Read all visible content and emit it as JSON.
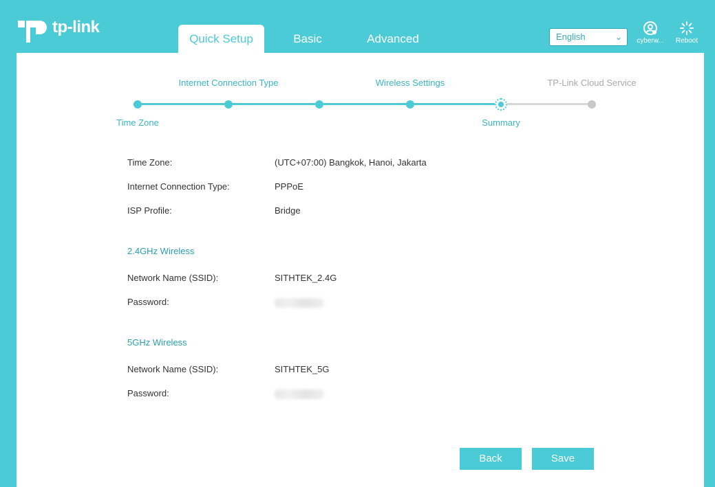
{
  "header": {
    "logo_text": "tp-link",
    "tabs": [
      {
        "label": "Quick Setup",
        "active": true
      },
      {
        "label": "Basic",
        "active": false
      },
      {
        "label": "Advanced",
        "active": false
      }
    ],
    "language": {
      "selected": "English"
    },
    "user_label": "cyberw...",
    "reboot_label": "Reboot"
  },
  "colors": {
    "accent": "#4acbd6",
    "inactive": "#c8c8c8",
    "section_text": "#2a9fb0"
  },
  "progress": {
    "steps": [
      {
        "label": "Time Zone",
        "state": "done"
      },
      {
        "label": "Internet Connection Type",
        "state": "done"
      },
      {
        "label": "",
        "state": "done"
      },
      {
        "label": "Wireless Settings",
        "state": "done"
      },
      {
        "label": "Summary",
        "state": "current"
      },
      {
        "label": "TP-Link Cloud Service",
        "state": "todo"
      }
    ]
  },
  "summary": {
    "general": [
      {
        "label": "Time Zone:",
        "value": "(UTC+07:00) Bangkok, Hanoi, Jakarta"
      },
      {
        "label": "Internet Connection Type:",
        "value": "PPPoE"
      },
      {
        "label": "ISP Profile:",
        "value": "Bridge"
      }
    ],
    "wireless_24": {
      "title": "2.4GHz Wireless",
      "ssid_label": "Network Name (SSID):",
      "ssid_value": "SITHTEK_2.4G",
      "password_label": "Password:"
    },
    "wireless_5": {
      "title": "5GHz Wireless",
      "ssid_label": "Network Name (SSID):",
      "ssid_value": "SITHTEK_5G",
      "password_label": "Password:"
    }
  },
  "buttons": {
    "back": "Back",
    "save": "Save"
  }
}
